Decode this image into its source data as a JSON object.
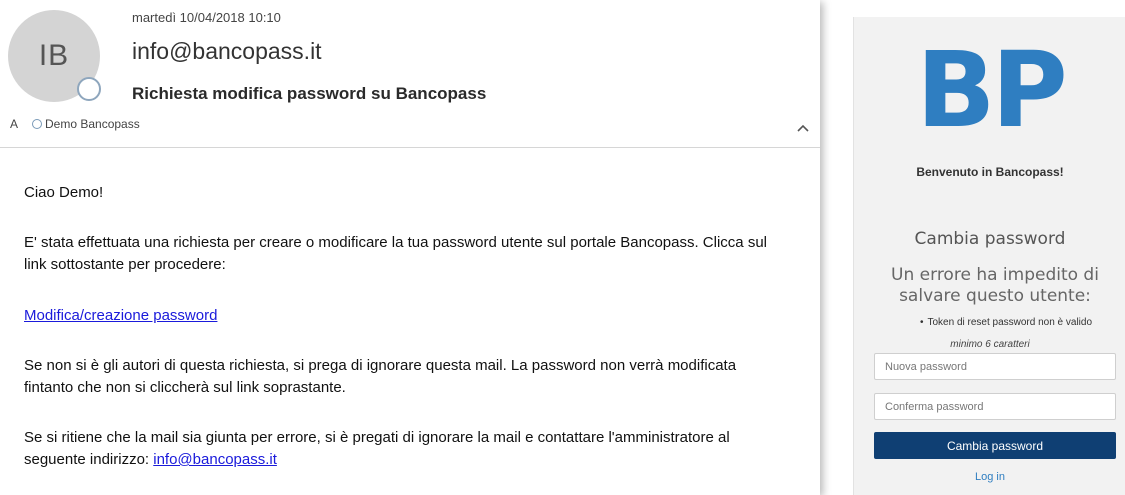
{
  "email": {
    "date": "martedì 10/04/2018 10:10",
    "avatar_initials": "IB",
    "from": "info@bancopass.it",
    "subject": "Richiesta modifica password su Bancopass",
    "to_label": "A",
    "to_recipient": "Demo Bancopass",
    "body": {
      "greeting": "Ciao Demo!",
      "intro": "E' stata effettuata una richiesta per creare o modificare la tua password utente sul portale Bancopass. Clicca sul link sottostante per procedere:",
      "link_text": "Modifica/creazione password",
      "ignore_text": "Se non si è gli autori di questa richiesta, si prega di ignorare questa mail. La password non verrà modificata fintanto che non si cliccherà sul link soprastante.",
      "error_text": "Se si ritiene che la mail sia giunta per errore, si è pregati di ignorare la mail e contattare l'amministratore al seguente indirizzo: ",
      "contact_email": "info@bancopass.it"
    }
  },
  "login": {
    "logo_text": "BP",
    "welcome": "Benvenuto in Bancopass!",
    "title": "Cambia password",
    "error_title": "Un errore ha impedito di salvare questo utente:",
    "errors": [
      "Token di reset password non è valido"
    ],
    "min_hint": "minimo 6 caratteri",
    "new_password_placeholder": "Nuova password",
    "confirm_password_placeholder": "Conferma password",
    "submit_label": "Cambia password",
    "login_link": "Log in"
  },
  "colors": {
    "brand_blue": "#2f7ec1",
    "button_navy": "#0f3f73",
    "link_blue": "#1a1adb"
  }
}
